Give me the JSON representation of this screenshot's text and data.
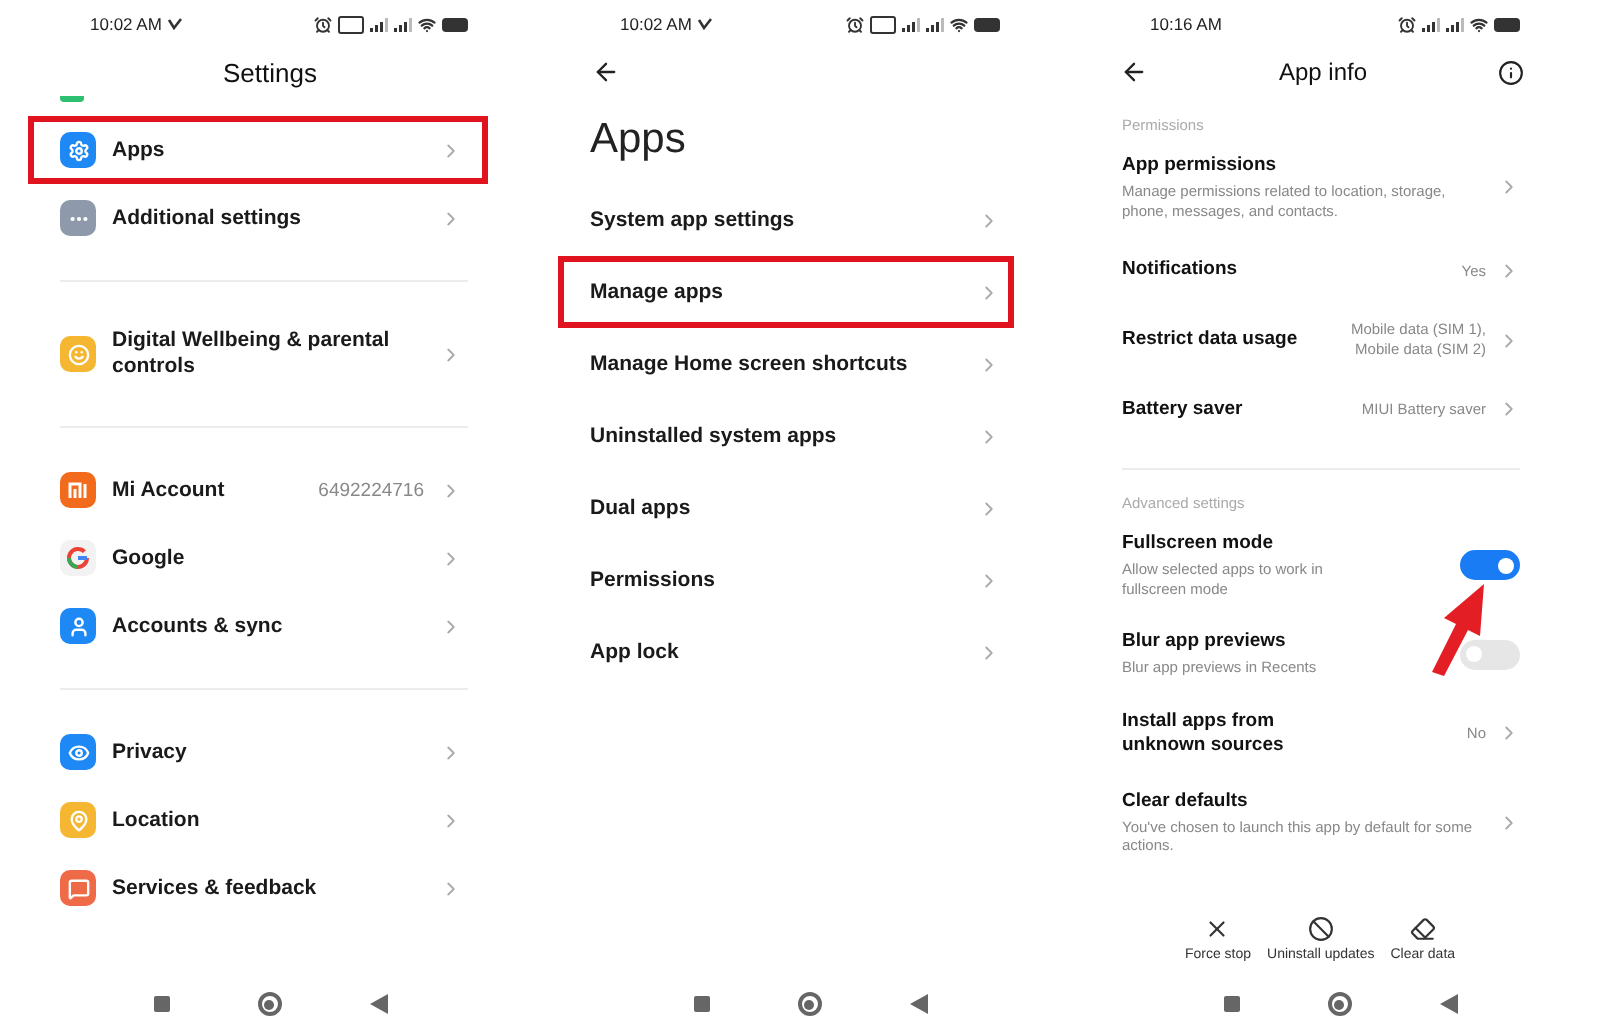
{
  "screens": [
    {
      "kind": "settings",
      "status_bar": {
        "time": "10:02 AM",
        "notification": true,
        "vpn": true
      },
      "title": "Settings",
      "groups": [
        {
          "items": [
            {
              "label": "Apps",
              "color": "#1e88f5",
              "highlighted": true
            },
            {
              "label": "Additional settings",
              "color": "#8e9aab",
              "highlighted": false
            }
          ]
        },
        {
          "items": [
            {
              "label": "Digital Wellbeing & parental controls",
              "color": "#f5b731",
              "highlighted": false
            }
          ]
        },
        {
          "items": [
            {
              "label": "Mi Account",
              "value": "6492224716",
              "color": "#f26a1b",
              "highlighted": false
            },
            {
              "label": "Google",
              "color": "#f2f2f2",
              "highlighted": false
            },
            {
              "label": "Accounts & sync",
              "color": "#1e88f5",
              "highlighted": false
            }
          ]
        },
        {
          "items": [
            {
              "label": "Privacy",
              "color": "#1e88f5",
              "highlighted": false
            },
            {
              "label": "Location",
              "color": "#f5b731",
              "highlighted": false
            },
            {
              "label": "Services & feedback",
              "color": "#ef6a46",
              "highlighted": false
            }
          ]
        }
      ]
    },
    {
      "kind": "apps",
      "status_bar": {
        "time": "10:02 AM",
        "notification": true,
        "vpn": true
      },
      "title": "Apps",
      "items": [
        {
          "label": "System app settings",
          "highlighted": false
        },
        {
          "label": "Manage apps",
          "highlighted": true
        },
        {
          "label": "Manage Home screen shortcuts",
          "highlighted": false
        },
        {
          "label": "Uninstalled system apps",
          "highlighted": false
        },
        {
          "label": "Dual apps",
          "highlighted": false
        },
        {
          "label": "Permissions",
          "highlighted": false
        },
        {
          "label": "App lock",
          "highlighted": false
        }
      ]
    },
    {
      "kind": "app_info",
      "status_bar": {
        "time": "10:16 AM",
        "notification": false,
        "vpn": false
      },
      "title": "App info",
      "sections": [
        {
          "heading": "Permissions",
          "items": [
            {
              "kind": "link",
              "label": "App permissions",
              "description": "Manage permissions related to location, storage, phone, messages, and contacts."
            },
            {
              "kind": "link",
              "label": "Notifications",
              "value": "Yes"
            },
            {
              "kind": "link",
              "label": "Restrict data usage",
              "value": "Mobile data (SIM 1), Mobile data (SIM 2)"
            },
            {
              "kind": "link",
              "label": "Battery saver",
              "value": "MIUI Battery saver"
            }
          ]
        },
        {
          "heading": "Advanced settings",
          "items": [
            {
              "kind": "toggle",
              "label": "Fullscreen mode",
              "description": "Allow selected apps to work in fullscreen mode",
              "on": true
            },
            {
              "kind": "toggle",
              "label": "Blur app previews",
              "description": "Blur app previews in Recents",
              "on": false
            },
            {
              "kind": "link",
              "label": "Install apps from unknown sources",
              "value": "No"
            },
            {
              "kind": "link",
              "label": "Clear defaults",
              "description": "You've chosen to launch this app by default for some actions."
            }
          ]
        }
      ],
      "actions": [
        {
          "label": "Force stop"
        },
        {
          "label": "Uninstall updates"
        },
        {
          "label": "Clear data"
        }
      ]
    }
  ]
}
